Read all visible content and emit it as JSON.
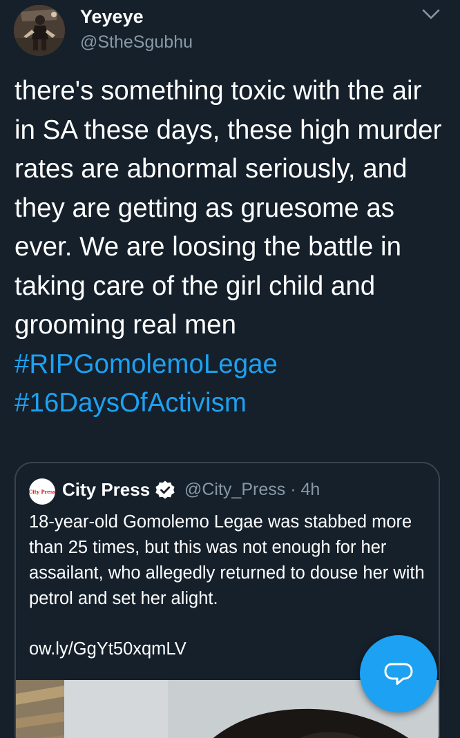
{
  "tweet": {
    "display_name": "Yeyeye",
    "handle": "@StheSgubhu",
    "text_main": "there's something toxic with the air in SA these days, these high murder rates are abnormal seriously, and they are getting as gruesome as ever. We are loosing the battle in taking care of the girl child and grooming real men ",
    "hashtag_1": "#RIPGomolemoLegae",
    "hashtag_2": "#16DaysOfActivism"
  },
  "quoted_tweet": {
    "logo_text": "City Press",
    "name": "City Press",
    "verified": true,
    "handle": "@City_Press",
    "separator": "·",
    "time": "4h",
    "text": "18-year-old Gomolemo Legae was stabbed more than 25 times, but this was not enough for her assailant, who allegedly returned to douse her with petrol and set her alight.",
    "link": "ow.ly/GgYt50xqmLV"
  },
  "icons": {
    "caret": "chevron-down-icon",
    "verified": "verified-badge-icon",
    "compose": "reply-bubble-icon"
  },
  "colors": {
    "background": "#15202b",
    "accent": "#1da1f2",
    "secondary_text": "#8899a6",
    "border": "#38444d"
  }
}
